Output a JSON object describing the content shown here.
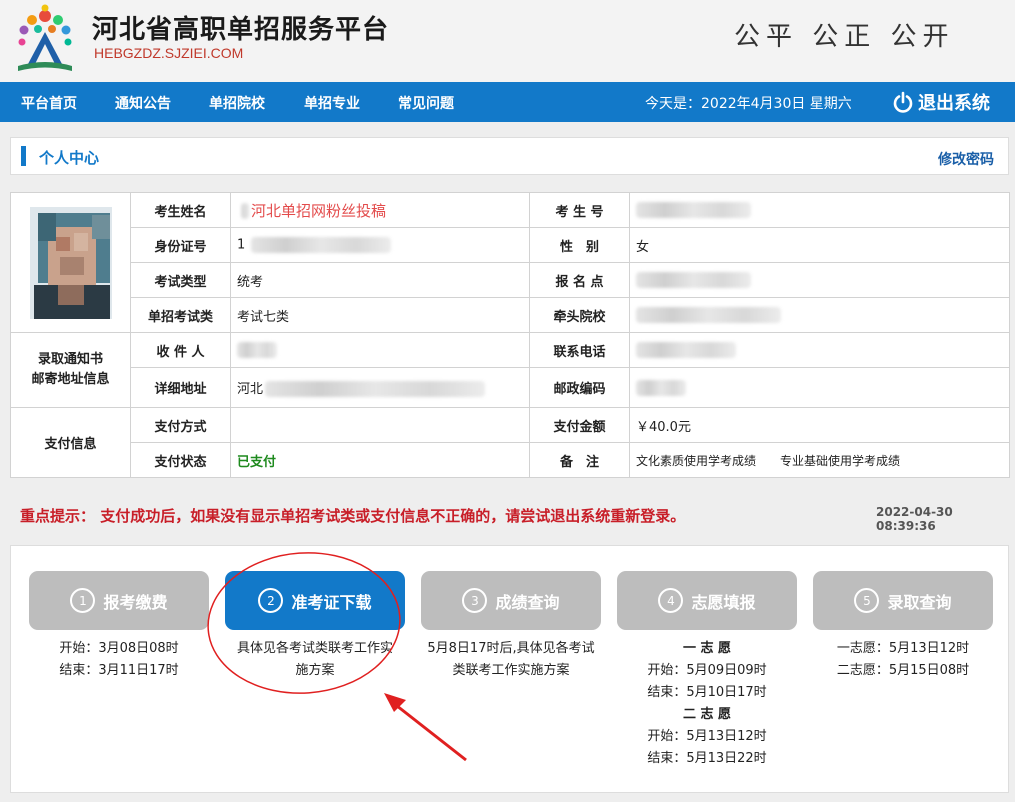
{
  "header": {
    "title": "河北省高职单招服务平台",
    "url": "HEBGZDZ.SJZIEI.COM",
    "slogan": "公平  公正  公开"
  },
  "nav": {
    "items": [
      {
        "label": "平台首页"
      },
      {
        "label": "通知公告"
      },
      {
        "label": "单招院校"
      },
      {
        "label": "单招专业"
      },
      {
        "label": "常见问题"
      }
    ],
    "date": "今天是：2022年4月30日 星期六",
    "logout": "退出系统"
  },
  "personal": {
    "title": "个人中心",
    "change_password": "修改密码"
  },
  "info": {
    "name_label": "考生姓名",
    "name_value": "河北单招网粉丝投稿",
    "exam_no_label": "考 生 号",
    "id_label": "身份证号",
    "id_value": "1",
    "gender_label": "性　别",
    "gender_value": "女",
    "exam_type_label": "考试类型",
    "exam_type_value": "统考",
    "site_label": "报 名 点",
    "category_label": "单招考试类",
    "category_value": "考试七类",
    "lead_school_label": "牵头院校",
    "mail_section": "录取通知书\n邮寄地址信息",
    "recipient_label": "收 件 人",
    "phone_label": "联系电话",
    "address_label": "详细地址",
    "address_value": "河北",
    "postcode_label": "邮政编码",
    "pay_section": "支付信息",
    "pay_method_label": "支付方式",
    "amount_label": "支付金额",
    "amount_value": "￥40.0元",
    "pay_status_label": "支付状态",
    "pay_status_value": "已支付",
    "remark_label": "备　注",
    "remark_value": "文化素质使用学考成绩　　专业基础使用学考成绩"
  },
  "notice": {
    "label": "重点提示：",
    "text": "支付成功后，如果没有显示单招考试类或支付信息不正确的，请尝试退出系统重新登录。",
    "timestamp": "2022-04-30 08:39:36"
  },
  "steps": [
    {
      "num": "1",
      "label": "报考缴费",
      "lines": [
        "开始：3月08日08时",
        "结束：3月11日17时"
      ]
    },
    {
      "num": "2",
      "label": "准考证下载",
      "lines": [
        "具体见各考试类联考工作实施方案"
      ]
    },
    {
      "num": "3",
      "label": "成绩查询",
      "lines": [
        "5月8日17时后,具体见各考试类联考工作实施方案"
      ]
    },
    {
      "num": "4",
      "label": "志愿填报",
      "lines": [
        "一 志 愿",
        "开始：5月09日09时",
        "结束：5月10日17时",
        "二 志 愿",
        "开始：5月13日12时",
        "结束：5月13日22时"
      ]
    },
    {
      "num": "5",
      "label": "录取查询",
      "lines": [
        "一志愿：5月13日12时",
        "二志愿：5月15日08时"
      ]
    }
  ],
  "colors": {
    "nav_bg": "#1279c9",
    "active_step": "#1279c9",
    "inactive_step": "#bdbdbd",
    "notice": "#c81e28",
    "annotation": "#e02020"
  }
}
